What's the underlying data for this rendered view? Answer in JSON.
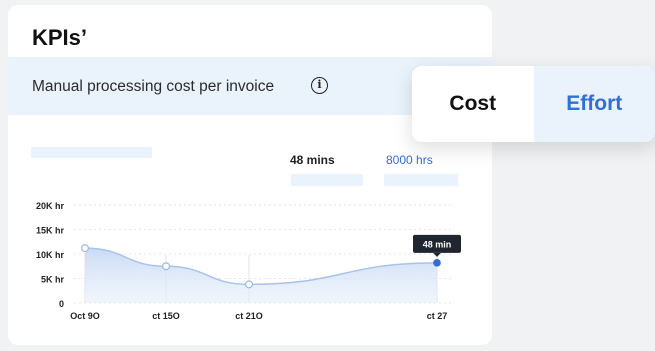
{
  "card": {
    "title": "KPIs’",
    "kpi_label": "Manual processing cost per invoice",
    "info_icon": "info-icon",
    "metric_time": "48 mins",
    "metric_hours": "8000 hrs"
  },
  "toggle": {
    "options": [
      "Cost",
      "Effort"
    ],
    "selected": "Effort"
  },
  "colors": {
    "accent": "#2f6fd6",
    "band": "#eaf2fb"
  },
  "chart_data": {
    "type": "area",
    "categories": [
      "Oct 9O",
      "ct 15O",
      "ct 21O",
      "ct 27"
    ],
    "yticks": [
      "20K hr",
      "15K hr",
      "10K hr",
      "5K hr",
      "0"
    ],
    "ylim": [
      0,
      20000
    ],
    "series": [
      {
        "values": [
          11200,
          7500,
          3800,
          8200
        ]
      }
    ],
    "tooltip": "48 min",
    "grid": true
  }
}
